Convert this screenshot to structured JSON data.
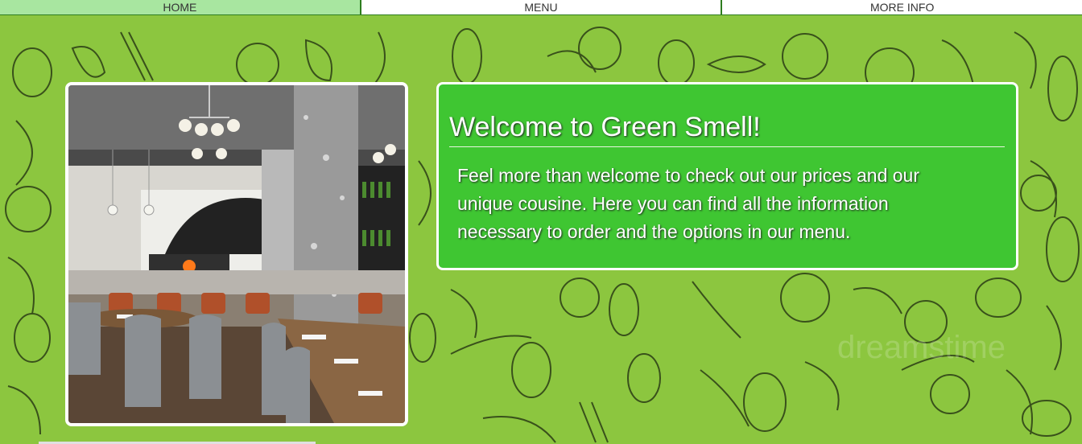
{
  "nav": {
    "items": [
      {
        "label": "HOME"
      },
      {
        "label": "MENU"
      },
      {
        "label": "MORE INFO"
      }
    ]
  },
  "hero_image": {
    "alt": "Restaurant dining room interior",
    "icon": "restaurant-photo"
  },
  "welcome": {
    "title": "Welcome to Green Smell!",
    "body": "Feel more than welcome to check out our prices and our unique cousine. Here you can find all the information necessary to order and the options in our menu."
  },
  "colors": {
    "background": "#8cc63f",
    "panel": "#3fc632",
    "nav_active": "#a8e6a0",
    "nav_border": "#2e7d1f"
  }
}
